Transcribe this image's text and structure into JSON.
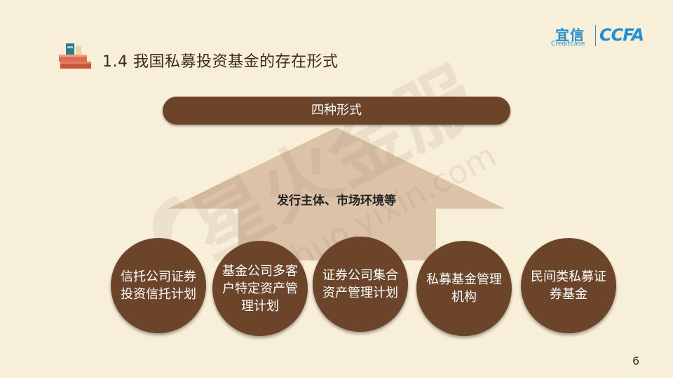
{
  "header": {
    "title": "1.4 我国私募投资基金的存在形式"
  },
  "logos": {
    "yixin_cn": "宜信",
    "yixin_en": "CreditEase",
    "ccfa": "CCFA"
  },
  "banner": {
    "label": "四种形式"
  },
  "house": {
    "caption": "发行主体、市场环境等"
  },
  "forms": [
    {
      "label": "信托公司证券投资信托计划"
    },
    {
      "label": "基金公司多客户特定资产管理计划"
    },
    {
      "label": "证券公司集合资产管理计划"
    },
    {
      "label": "私募基金管理机构"
    },
    {
      "label": "民间类私募证券基金"
    }
  ],
  "watermark": {
    "cn": "星火金服",
    "url": "xinghuo.yixin.com"
  },
  "page_number": "6",
  "colors": {
    "background": "#f8efd9",
    "brown": "#6b4429",
    "house": "#dcc2a7",
    "logo_blue": "#1f8fd6"
  }
}
